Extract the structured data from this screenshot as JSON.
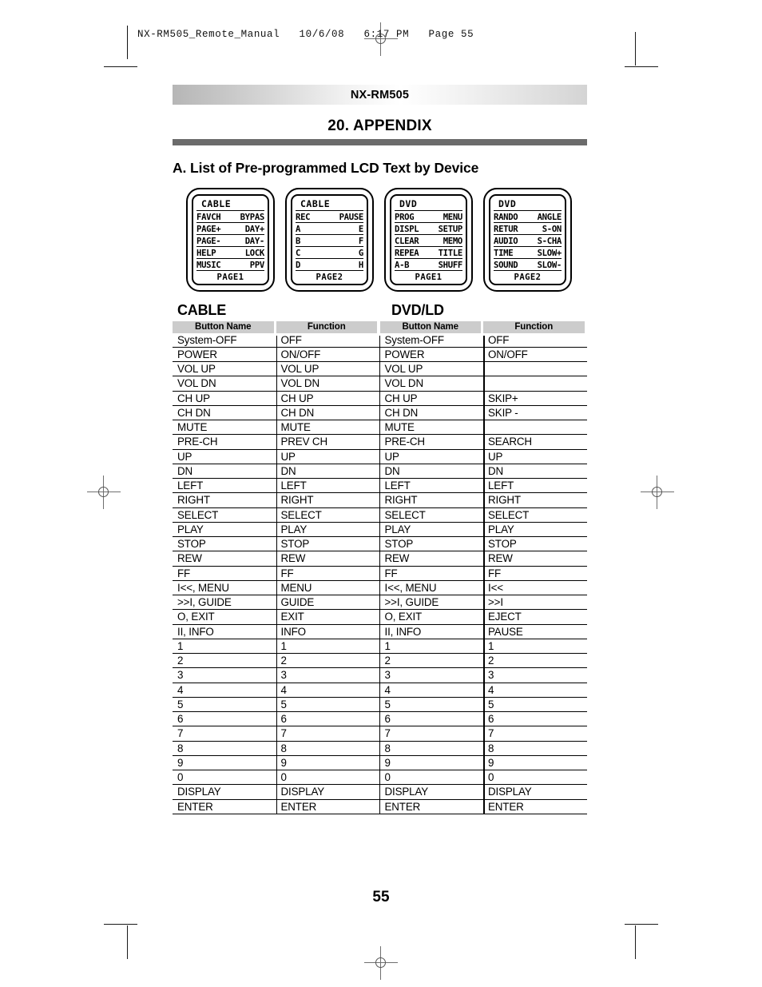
{
  "slug": "NX-RM505_Remote_Manual   10/6/08   6:17 PM   Page 55",
  "header": {
    "title": "NX-RM505"
  },
  "section": {
    "title": "20. APPENDIX",
    "subtitle": "A.   List of Pre-programmed LCD Text by Device"
  },
  "lcd_screens": [
    {
      "title": "CABLE",
      "lines": [
        {
          "left": "FAVCH",
          "right": "BYPAS"
        },
        {
          "left": "PAGE+",
          "right": "DAY+"
        },
        {
          "left": "PAGE-",
          "right": "DAY-"
        },
        {
          "left": "HELP",
          "right": "LOCK"
        },
        {
          "left": "MUSIC",
          "right": "PPV"
        }
      ],
      "page": "PAGE1"
    },
    {
      "title": "CABLE",
      "lines": [
        {
          "left": "REC",
          "right": "PAUSE"
        },
        {
          "left": "A",
          "right": "E"
        },
        {
          "left": "B",
          "right": "F"
        },
        {
          "left": "C",
          "right": "G"
        },
        {
          "left": "D",
          "right": "H"
        }
      ],
      "page": "PAGE2"
    },
    {
      "title": "DVD",
      "lines": [
        {
          "left": "PROG",
          "right": "MENU"
        },
        {
          "left": "DISPL",
          "right": "SETUP"
        },
        {
          "left": "CLEAR",
          "right": "MEMO"
        },
        {
          "left": "REPEA",
          "right": "TITLE"
        },
        {
          "left": "A-B",
          "right": "SHUFF"
        }
      ],
      "page": "PAGE1"
    },
    {
      "title": "DVD",
      "lines": [
        {
          "left": "RANDO",
          "right": "ANGLE"
        },
        {
          "left": "RETUR",
          "right": "S-ON"
        },
        {
          "left": "AUDIO",
          "right": "S-CHA"
        },
        {
          "left": "TIME",
          "right": "SLOW+"
        },
        {
          "left": "SOUND",
          "right": "SLOW-"
        }
      ],
      "page": "PAGE2"
    }
  ],
  "tables": [
    {
      "device": "CABLE",
      "columns": [
        "Button Name",
        "Function"
      ],
      "rows": [
        [
          "System-OFF",
          "OFF"
        ],
        [
          "POWER",
          "ON/OFF"
        ],
        [
          "VOL UP",
          "VOL UP"
        ],
        [
          "VOL DN",
          "VOL DN"
        ],
        [
          "CH UP",
          "CH UP"
        ],
        [
          "CH DN",
          "CH DN"
        ],
        [
          "MUTE",
          "MUTE"
        ],
        [
          "PRE-CH",
          "PREV CH"
        ],
        [
          "UP",
          "UP"
        ],
        [
          "DN",
          "DN"
        ],
        [
          "LEFT",
          "LEFT"
        ],
        [
          "RIGHT",
          "RIGHT"
        ],
        [
          "SELECT",
          "SELECT"
        ],
        [
          "PLAY",
          "PLAY"
        ],
        [
          "STOP",
          "STOP"
        ],
        [
          "REW",
          "REW"
        ],
        [
          "FF",
          "FF"
        ],
        [
          "I<<, MENU",
          "MENU"
        ],
        [
          ">>I, GUIDE",
          "GUIDE"
        ],
        [
          "O, EXIT",
          "EXIT"
        ],
        [
          "II, INFO",
          "INFO"
        ],
        [
          "1",
          "1"
        ],
        [
          "2",
          "2"
        ],
        [
          "3",
          "3"
        ],
        [
          "4",
          "4"
        ],
        [
          "5",
          "5"
        ],
        [
          "6",
          "6"
        ],
        [
          "7",
          "7"
        ],
        [
          "8",
          "8"
        ],
        [
          "9",
          "9"
        ],
        [
          "0",
          "0"
        ],
        [
          "DISPLAY",
          "DISPLAY"
        ],
        [
          "ENTER",
          "ENTER"
        ]
      ]
    },
    {
      "device": "DVD/LD",
      "columns": [
        "Button Name",
        "Function"
      ],
      "rows": [
        [
          "System-OFF",
          "OFF"
        ],
        [
          "POWER",
          "ON/OFF"
        ],
        [
          "VOL UP",
          ""
        ],
        [
          "VOL DN",
          ""
        ],
        [
          "CH UP",
          "SKIP+"
        ],
        [
          "CH DN",
          "SKIP -"
        ],
        [
          "MUTE",
          ""
        ],
        [
          "PRE-CH",
          "SEARCH"
        ],
        [
          "UP",
          "UP"
        ],
        [
          "DN",
          "DN"
        ],
        [
          "LEFT",
          "LEFT"
        ],
        [
          "RIGHT",
          "RIGHT"
        ],
        [
          "SELECT",
          "SELECT"
        ],
        [
          "PLAY",
          "PLAY"
        ],
        [
          "STOP",
          "STOP"
        ],
        [
          "REW",
          "REW"
        ],
        [
          "FF",
          "FF"
        ],
        [
          "I<<, MENU",
          "I<<"
        ],
        [
          ">>I, GUIDE",
          ">>I"
        ],
        [
          "O, EXIT",
          "EJECT"
        ],
        [
          "II, INFO",
          "PAUSE"
        ],
        [
          "1",
          "1"
        ],
        [
          "2",
          "2"
        ],
        [
          "3",
          "3"
        ],
        [
          "4",
          "4"
        ],
        [
          "5",
          "5"
        ],
        [
          "6",
          "6"
        ],
        [
          "7",
          "7"
        ],
        [
          "8",
          "8"
        ],
        [
          "9",
          "9"
        ],
        [
          "0",
          "0"
        ],
        [
          "DISPLAY",
          "DISPLAY"
        ],
        [
          "ENTER",
          "ENTER"
        ]
      ]
    }
  ],
  "page_number": "55"
}
